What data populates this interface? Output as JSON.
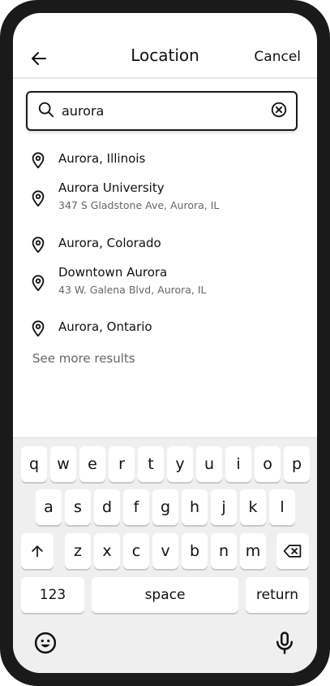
{
  "header": {
    "title": "Location",
    "cancel_label": "Cancel"
  },
  "search": {
    "value": "aurora"
  },
  "results": [
    {
      "name": "Aurora, Illinois",
      "address": ""
    },
    {
      "name": "Aurora University",
      "address": "347 S Gladstone Ave, Aurora, IL"
    },
    {
      "name": "Aurora, Colorado",
      "address": ""
    },
    {
      "name": "Downtown Aurora",
      "address": "43 W. Galena Blvd, Aurora, IL"
    },
    {
      "name": "Aurora, Ontario",
      "address": ""
    }
  ],
  "see_more_label": "See more results",
  "keyboard": {
    "row1": [
      "q",
      "w",
      "e",
      "r",
      "t",
      "y",
      "u",
      "i",
      "o",
      "p"
    ],
    "row2": [
      "a",
      "s",
      "d",
      "f",
      "g",
      "h",
      "j",
      "k",
      "l"
    ],
    "row3": [
      "z",
      "x",
      "c",
      "v",
      "b",
      "n",
      "m"
    ],
    "numbers_label": "123",
    "space_label": "space",
    "return_label": "return"
  },
  "icons": {
    "back": "arrow-left-icon",
    "search": "search-icon",
    "clear": "clear-circle-x-icon",
    "pin": "map-pin-icon",
    "shift": "shift-arrow-up-icon",
    "delete": "backspace-icon",
    "emoji": "smiley-icon",
    "mic": "microphone-icon"
  }
}
